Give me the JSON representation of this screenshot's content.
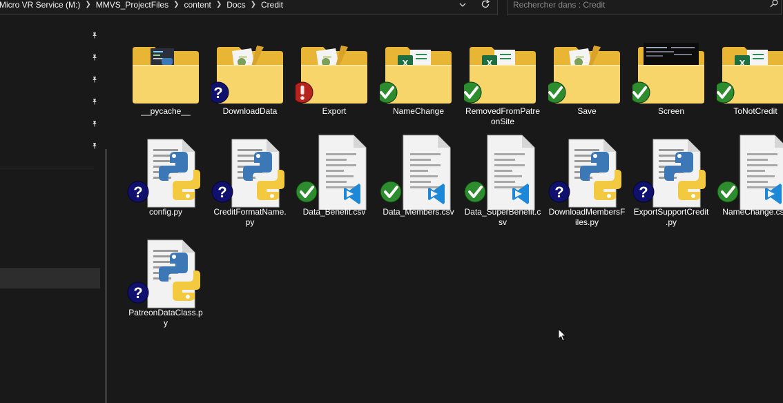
{
  "breadcrumb": [
    "Micro VR Service (M:)",
    "MMVS_ProjectFiles",
    "content",
    "Docs",
    "Credit"
  ],
  "search": {
    "placeholder": "Rechercher dans : Credit"
  },
  "colors": {
    "background": "#191919",
    "folder_back": "#e8b535",
    "folder_front": "#f7d56a",
    "status_ok": "#2d8c2d",
    "status_unknown": "#10106e",
    "status_error": "#b5231c",
    "python_blue": "#3b78b5",
    "python_yellow": "#f3c93f",
    "vscode_blue": "#1e88d8"
  },
  "items": [
    {
      "name": "__pycache__",
      "kind": "folder",
      "thumb": "terminal",
      "status": "none"
    },
    {
      "name": "DownloadData",
      "kind": "folder",
      "thumb": "pythonfile",
      "status": "unknown"
    },
    {
      "name": "Export",
      "kind": "folder",
      "thumb": "pythonfile",
      "status": "error"
    },
    {
      "name": "NameChange",
      "kind": "folder",
      "thumb": "excel",
      "status": "ok"
    },
    {
      "name": "RemovedFromPatreonSite",
      "kind": "folder",
      "thumb": "excel",
      "status": "ok"
    },
    {
      "name": "Save",
      "kind": "folder",
      "thumb": "pythonfile",
      "status": "ok"
    },
    {
      "name": "Screen",
      "kind": "folder",
      "thumb": "dark",
      "status": "ok"
    },
    {
      "name": "ToNotCredit",
      "kind": "folder",
      "thumb": "excel",
      "status": "ok"
    },
    {
      "name": "config.py",
      "kind": "py",
      "status": "unknown"
    },
    {
      "name": "CreditFormatName.py",
      "kind": "py",
      "status": "unknown"
    },
    {
      "name": "Data_Benefit.csv",
      "kind": "csv",
      "status": "ok"
    },
    {
      "name": "Data_Members.csv",
      "kind": "csv",
      "status": "ok"
    },
    {
      "name": "Data_SuperBenefit.csv",
      "kind": "csv",
      "status": "ok"
    },
    {
      "name": "DownloadMembersFiles.py",
      "kind": "py",
      "status": "unknown"
    },
    {
      "name": "ExportSupportCredit.py",
      "kind": "py",
      "status": "unknown"
    },
    {
      "name": "NameChange.csv",
      "kind": "csv",
      "status": "ok"
    },
    {
      "name": "PatreonDataClass.py",
      "kind": "py",
      "status": "unknown"
    }
  ]
}
